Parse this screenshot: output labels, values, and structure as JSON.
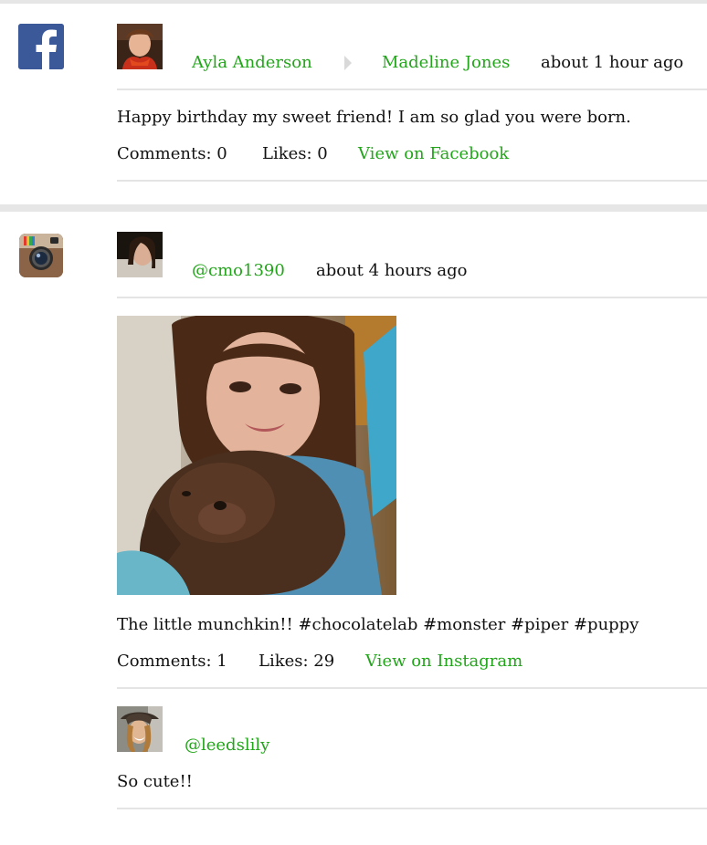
{
  "posts": [
    {
      "network": "facebook",
      "network_icon": "facebook-icon",
      "from_name": "Ayla Anderson",
      "to_name": "Madeline Jones",
      "timestamp": "about 1 hour ago",
      "message": "Happy birthday my sweet friend! I am so glad you were born.",
      "comments_label": "Comments: 0",
      "likes_label": "Likes: 0",
      "view_link": "View on Facebook"
    },
    {
      "network": "instagram",
      "network_icon": "instagram-icon",
      "username": "@cmo1390",
      "timestamp": "about 4 hours ago",
      "caption": "The little munchkin!! #chocolatelab #monster #piper #puppy",
      "comments_label": "Comments: 1",
      "likes_label": "Likes: 29",
      "view_link": "View on Instagram",
      "comment": {
        "username": "@leedslily",
        "text": "So cute!!"
      }
    }
  ],
  "colors": {
    "link": "#22a51a",
    "facebook": "#3b5998",
    "divider": "#e4e4e4"
  }
}
